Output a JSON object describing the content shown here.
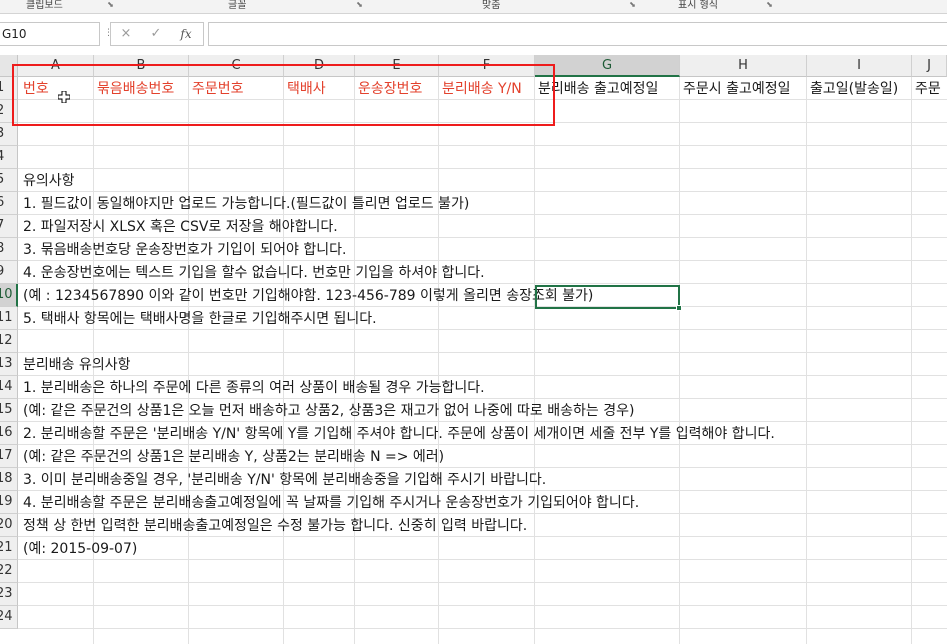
{
  "ribbon": {
    "groups": [
      "클립보드",
      "글꼴",
      "맞춤",
      "표시 형식"
    ]
  },
  "formula_bar": {
    "name_box": "G10",
    "cancel_icon": "×",
    "enter_icon": "✓",
    "fx_label": "fx",
    "value": ""
  },
  "columns": [
    "A",
    "B",
    "C",
    "D",
    "E",
    "F",
    "G",
    "H",
    "I",
    "J"
  ],
  "selected_column": "G",
  "selected_row": "10",
  "rows": [
    "1",
    "2",
    "3",
    "4",
    "5",
    "6",
    "7",
    "8",
    "9",
    "10",
    "11",
    "12",
    "13",
    "14",
    "15",
    "16",
    "17",
    "18",
    "19",
    "20",
    "21",
    "22",
    "23",
    "24"
  ],
  "header_row": {
    "A": "번호",
    "B": "묶음배송번호",
    "C": "주문번호",
    "D": "택배사",
    "E": "운송장번호",
    "F": "분리배송 Y/N",
    "G": "분리배송 출고예정일",
    "H": "주문시 출고예정일",
    "I": "출고일(발송일)",
    "J": "주문"
  },
  "notes": [
    {
      "row": 5,
      "text": "유의사항"
    },
    {
      "row": 6,
      "text": "1. 필드값이 동일해야지만 업로드 가능합니다.(필드값이 틀리면 업로드 불가)"
    },
    {
      "row": 7,
      "text": "2. 파일저장시 XLSX 혹은 CSV로 저장을 해야합니다."
    },
    {
      "row": 8,
      "text": "3. 묶음배송번호당 운송장번호가 기입이 되어야 합니다."
    },
    {
      "row": 9,
      "text": "4. 운송장번호에는 텍스트 기입을 할수 없습니다. 번호만 기입을 하셔야 합니다."
    },
    {
      "row": 10,
      "text": "(예 : 1234567890 이와 같이 번호만 기입해야함. 123-456-789 이렇게 올리면 송장조회 불가)"
    },
    {
      "row": 11,
      "text": "5. 택배사 항목에는 택배사명을 한글로 기입해주시면 됩니다."
    },
    {
      "row": 13,
      "text": "분리배송 유의사항"
    },
    {
      "row": 14,
      "text": "1. 분리배송은 하나의 주문에 다른 종류의 여러 상품이 배송될 경우 가능합니다."
    },
    {
      "row": 15,
      "text": "(예: 같은 주문건의 상품1은 오늘 먼저 배송하고 상품2, 상품3은 재고가 없어 나중에 따로 배송하는 경우)"
    },
    {
      "row": 16,
      "text": "2. 분리배송할 주문은 '분리배송 Y/N' 항목에 Y를 기입해 주셔야 합니다. 주문에 상품이 세개이면 세줄 전부 Y를 입력해야 합니다."
    },
    {
      "row": 17,
      "text": "(예: 같은 주문건의 상품1은 분리배송 Y, 상품2는 분리배송 N => 에러)"
    },
    {
      "row": 18,
      "text": "3. 이미 분리배송중일 경우, '분리배송 Y/N' 항목에 분리배송중을 기입해 주시기 바랍니다."
    },
    {
      "row": 19,
      "text": "4. 분리배송할 주문은 분리배송출고예정일에 꼭 날짜를 기입해 주시거나 운송장번호가 기입되어야 합니다."
    },
    {
      "row": 20,
      "text": "정책 상 한번 입력한 분리배송출고예정일은 수정 불가능 합니다. 신중히 입력 바랍니다."
    },
    {
      "row": 21,
      "text": "(예: 2015-09-07)"
    }
  ],
  "colors": {
    "header_red": "#e3412c",
    "highlight_box": "#ee1c1c",
    "selection_green": "#217346"
  }
}
